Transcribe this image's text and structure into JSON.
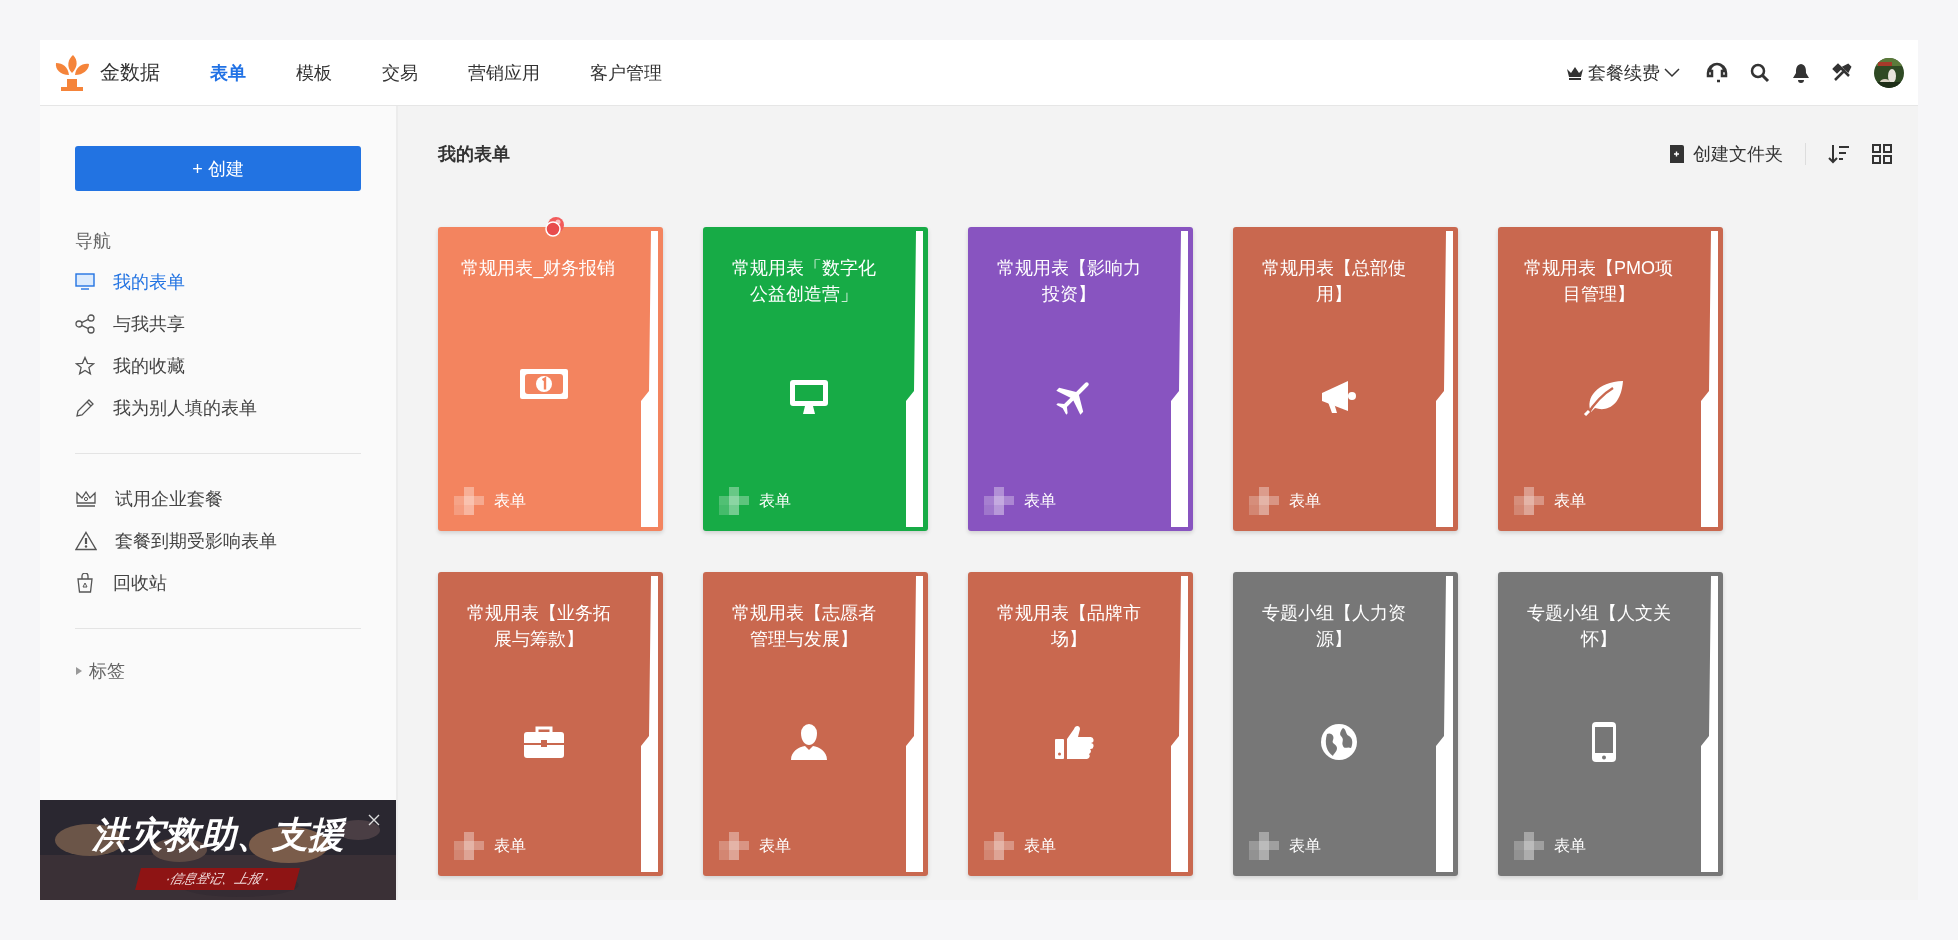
{
  "brand": {
    "name": "金数据"
  },
  "nav_tabs": [
    {
      "label": "表单",
      "selected": true
    },
    {
      "label": "模板",
      "selected": false
    },
    {
      "label": "交易",
      "selected": false
    },
    {
      "label": "营销应用",
      "selected": false
    },
    {
      "label": "客户管理",
      "selected": false
    }
  ],
  "header_actions": {
    "plan_renewal": "套餐续费"
  },
  "sidebar": {
    "create_button": "+ 创建",
    "nav_heading": "导航",
    "nav_items": [
      {
        "label": "我的表单",
        "kind": "monitor",
        "selected": true
      },
      {
        "label": "与我共享",
        "kind": "share",
        "selected": false
      },
      {
        "label": "我的收藏",
        "kind": "star",
        "selected": false
      },
      {
        "label": "我为别人填的表单",
        "kind": "pencil",
        "selected": false
      }
    ],
    "extra_items": [
      {
        "label": "试用企业套餐",
        "kind": "crown"
      },
      {
        "label": "套餐到期受影响表单",
        "kind": "warning"
      },
      {
        "label": "回收站",
        "kind": "trash"
      }
    ],
    "tags_label": "标签",
    "banner": {
      "kind": "picture",
      "headline": "洪灾救助、支援",
      "ribbon": "·信息登记、上报 ·"
    }
  },
  "main": {
    "title": "我的表单",
    "create_folder": "创建文件夹",
    "forms": [
      {
        "title": "常规用表_财务报销",
        "kind": "money",
        "color": "#f3845f",
        "pinned": true,
        "type_label": "表单"
      },
      {
        "title": "常规用表「数字化公益创造营」",
        "kind": "monitor",
        "color": "#17ab46",
        "pinned": false,
        "type_label": "表单"
      },
      {
        "title": "常规用表【影响力投资】",
        "kind": "plane",
        "color": "#8854c0",
        "pinned": false,
        "type_label": "表单"
      },
      {
        "title": "常规用表【总部使用】",
        "kind": "megaphone",
        "color": "#c9684f",
        "pinned": false,
        "type_label": "表单"
      },
      {
        "title": "常规用表【PMO项目管理】",
        "kind": "leaf",
        "color": "#c9684f",
        "pinned": false,
        "type_label": "表单"
      },
      {
        "title": "常规用表【业务拓展与筹款】",
        "kind": "briefcase",
        "color": "#c9684f",
        "pinned": false,
        "type_label": "表单"
      },
      {
        "title": "常规用表【志愿者管理与发展】",
        "kind": "person",
        "color": "#c9684f",
        "pinned": false,
        "type_label": "表单"
      },
      {
        "title": "常规用表【品牌市场】",
        "kind": "thumb",
        "color": "#c9684f",
        "pinned": false,
        "type_label": "表单"
      },
      {
        "title": "专题小组【人力资源】",
        "kind": "globe",
        "color": "#777777",
        "pinned": false,
        "type_label": "表单"
      },
      {
        "title": "专题小组【人文关怀】",
        "kind": "phone",
        "color": "#777777",
        "pinned": false,
        "type_label": "表单"
      }
    ]
  }
}
